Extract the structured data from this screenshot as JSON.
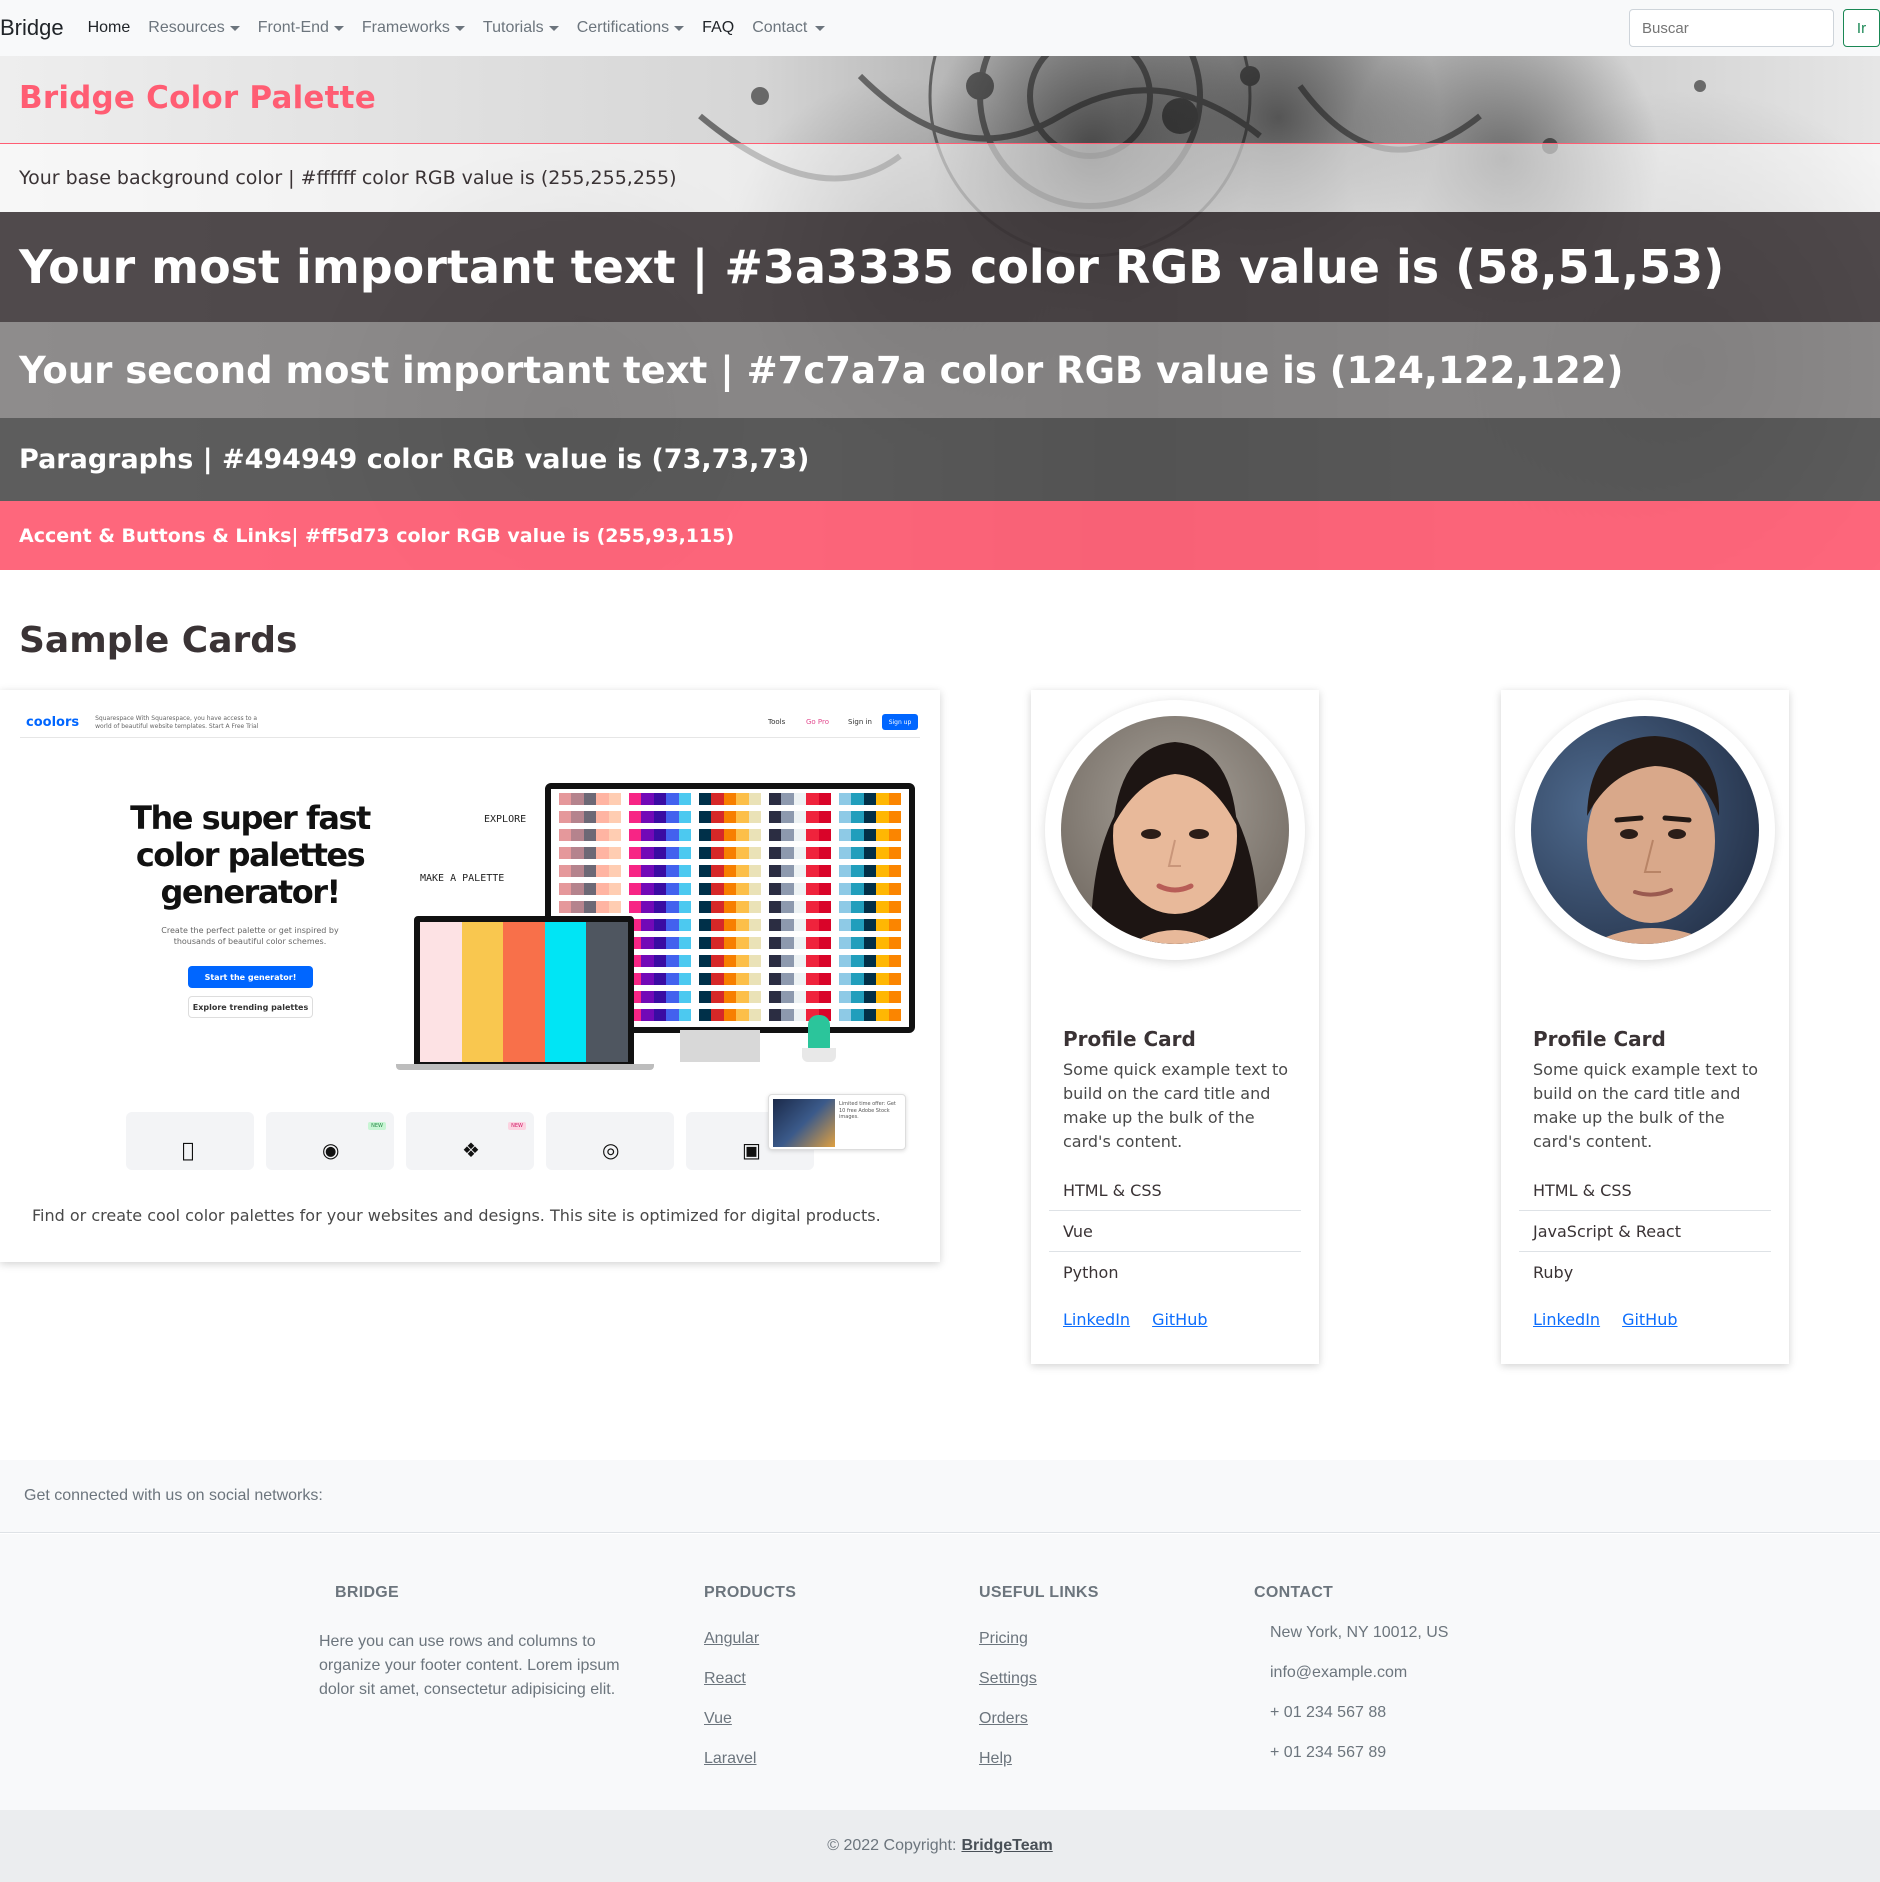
{
  "nav": {
    "brand": "Bridge",
    "items": [
      {
        "label": "Home",
        "dropdown": false
      },
      {
        "label": "Resources",
        "dropdown": true
      },
      {
        "label": "Front-End",
        "dropdown": true
      },
      {
        "label": "Frameworks",
        "dropdown": true
      },
      {
        "label": "Tutorials",
        "dropdown": true
      },
      {
        "label": "Certifications",
        "dropdown": true
      },
      {
        "label": "FAQ",
        "dropdown": false
      },
      {
        "label": "Contact",
        "dropdown": true
      }
    ],
    "search_placeholder": "Buscar",
    "search_button": "Ir"
  },
  "palette": {
    "title": "Bridge Color Palette",
    "base": "Your base background color | #ffffff color RGB value is (255,255,255)",
    "important": "Your most important text | #3a3335 color RGB value is (58,51,53)",
    "second": "Your second most important text | #7c7a7a color RGB value is (124,122,122)",
    "paragraphs": "Paragraphs | #494949 color RGB value is (73,73,73)",
    "accent": "Accent & Buttons & Links| #ff5d73 color RGB value is (255,93,115)",
    "colors": {
      "base": "#ffffff",
      "important": "#3a3335",
      "second": "#7c7a7a",
      "paragraph": "#494949",
      "accent": "#ff5d73"
    }
  },
  "cards": {
    "section_title": "Sample Cards",
    "feature": {
      "text": "Find or create cool color palettes for your websites and designs. This site is optimized for digital products.",
      "screenshot": {
        "logo": "coolors",
        "promo": "Squarespace With Squarespace, you have access to a world of beautiful website templates. Start A Free Trial",
        "tools": "Tools",
        "gopro": "Go Pro",
        "signin": "Sign in",
        "signup": "Sign up",
        "headline": "The super fast color palettes generator!",
        "subtext": "Create the perfect palette or get inspired by thousands of beautiful color schemes.",
        "btn_primary": "Start the generator!",
        "btn_secondary": "Explore trending palettes",
        "explore": "EXPLORE",
        "make": "MAKE A PALETTE",
        "new_badge": "NEW",
        "ad_text": "Limited time offer: Get 10 free Adobe Stock images."
      }
    },
    "profiles": [
      {
        "title": "Profile Card",
        "text": "Some quick example text to build on the card title and make up the bulk of the card's content.",
        "skills": [
          "HTML & CSS",
          "Vue",
          "Python"
        ],
        "links": [
          "LinkedIn",
          "GitHub"
        ]
      },
      {
        "title": "Profile Card",
        "text": "Some quick example text to build on the card title and make up the bulk of the card's content.",
        "skills": [
          "HTML & CSS",
          "JavaScript & React",
          "Ruby"
        ],
        "links": [
          "LinkedIn",
          "GitHub"
        ]
      }
    ]
  },
  "footer": {
    "social_text": "Get connected with us on social networks:",
    "bridge": {
      "heading": "BRIDGE",
      "text": "Here you can use rows and columns to organize your footer content. Lorem ipsum dolor sit amet, consectetur adipisicing elit."
    },
    "products": {
      "heading": "PRODUCTS",
      "links": [
        "Angular",
        "React",
        "Vue",
        "Laravel"
      ]
    },
    "useful": {
      "heading": "USEFUL LINKS",
      "links": [
        "Pricing",
        "Settings",
        "Orders",
        "Help"
      ]
    },
    "contact": {
      "heading": "CONTACT",
      "items": [
        "New York, NY 10012, US",
        "info@example.com",
        "+ 01 234 567 88",
        "+ 01 234 567 89"
      ]
    },
    "copyright": "© 2022 Copyright:",
    "copyright_link": "BridgeTeam"
  }
}
